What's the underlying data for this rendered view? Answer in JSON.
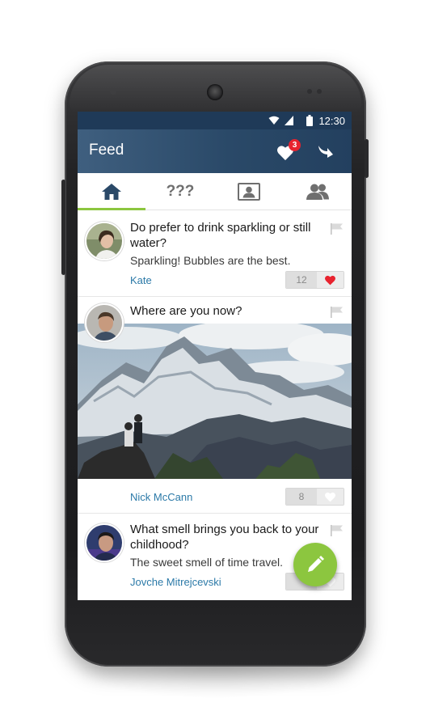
{
  "status_bar": {
    "time": "12:30",
    "icons": [
      "wifi-icon",
      "signal-icon",
      "battery-icon"
    ]
  },
  "app_bar": {
    "title": "Feed",
    "notification_count": "3",
    "actions": [
      "heart-icon",
      "back-arrow-icon"
    ]
  },
  "tabs": [
    {
      "icon": "home-icon",
      "label": "",
      "active": true
    },
    {
      "icon": "questions-icon",
      "label": "???",
      "active": false
    },
    {
      "icon": "profile-icon",
      "label": "",
      "active": false
    },
    {
      "icon": "friends-icon",
      "label": "",
      "active": false
    }
  ],
  "posts": [
    {
      "question": "Do prefer to drink sparkling or still water?",
      "answer": "Sparkling! Bubbles are the best.",
      "author": "Kate",
      "likes": "12",
      "liked": true
    },
    {
      "question": "Where are you now?",
      "answer": "",
      "author": "Nick McCann",
      "likes": "8",
      "liked": false,
      "has_photo": true
    },
    {
      "question": "What smell brings you back to your childhood?",
      "answer": "The sweet smell of time travel.",
      "author": "Jovche Mitrejcevski",
      "likes": "",
      "liked": false
    }
  ],
  "fab": {
    "icon": "pencil-icon"
  },
  "colors": {
    "status_bar": "#1f3a58",
    "app_bar": "#2a4968",
    "accent_green": "#8cc63f",
    "like_red": "#e8232f",
    "author_blue": "#2c7aa8"
  }
}
